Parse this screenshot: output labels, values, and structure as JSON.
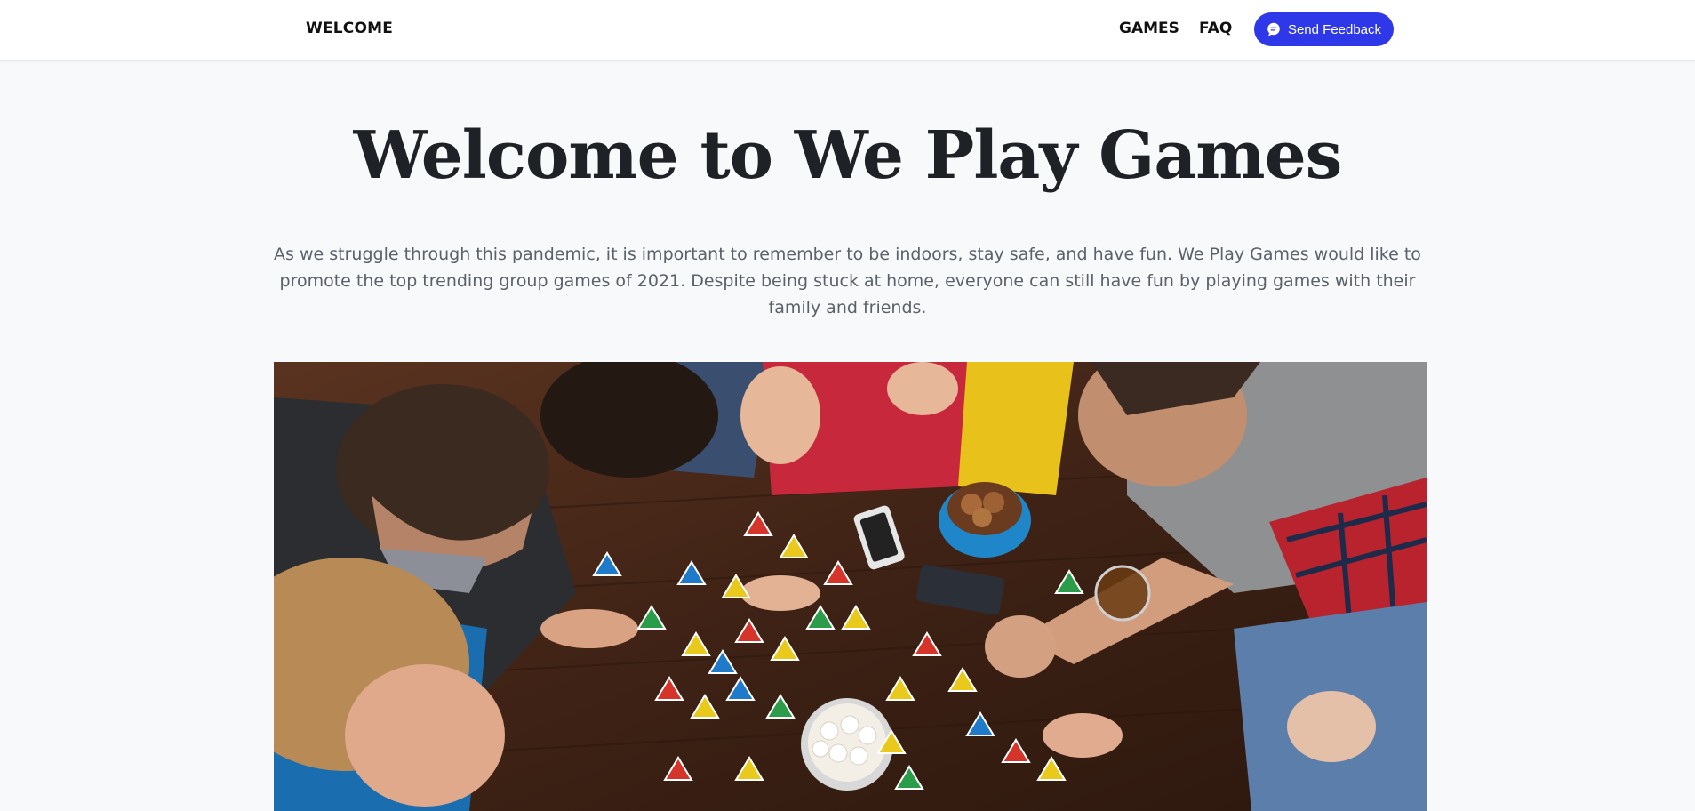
{
  "nav": {
    "brand": "WELCOME",
    "links": [
      "GAMES",
      "FAQ"
    ],
    "feedback_button": "Send Feedback",
    "feedback_icon": "chat-bubble-icon"
  },
  "hero": {
    "title": "Welcome to We Play Games",
    "text": "As we struggle through this pandemic, it is important to remember to be indoors, stay safe, and have fun. We Play Games would like to promote the top trending group games of 2021. Despite being stuck at home, everyone can still have fun by playing games with their family and friends.",
    "image_subject": "friends playing a board game around a wooden table"
  },
  "colors": {
    "accent": "#2f38e8",
    "background": "#f8f9fb",
    "title": "#1e2226",
    "body_text": "#5a6169"
  }
}
